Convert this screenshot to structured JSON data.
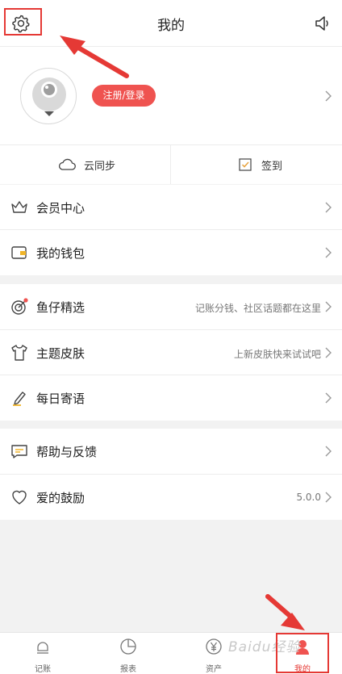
{
  "header": {
    "title": "我的"
  },
  "profile": {
    "login_label": "注册/登录"
  },
  "sync": {
    "cloud_label": "云同步",
    "checkin_label": "签到"
  },
  "menu": [
    {
      "label": "会员中心",
      "icon": "crown-icon"
    },
    {
      "label": "我的钱包",
      "icon": "wallet-icon"
    },
    {
      "label": "鱼仔精选",
      "sub": "记账分钱、社区话题都在这里",
      "icon": "target-icon"
    },
    {
      "label": "主题皮肤",
      "sub": "上新皮肤快来试试吧",
      "icon": "tshirt-icon"
    },
    {
      "label": "每日寄语",
      "icon": "pen-icon"
    },
    {
      "label": "帮助与反馈",
      "icon": "chat-icon"
    },
    {
      "label": "爱的鼓励",
      "sub": "5.0.0",
      "icon": "heart-icon"
    }
  ],
  "tabs": [
    {
      "label": "记账",
      "icon": "ledger-icon"
    },
    {
      "label": "报表",
      "icon": "pie-chart-icon"
    },
    {
      "label": "资产",
      "icon": "yen-icon"
    },
    {
      "label": "我的",
      "icon": "profile-icon",
      "active": true
    }
  ],
  "watermark": "Baidu经验",
  "colors": {
    "accent": "#ef5350",
    "annotation": "#e53935"
  }
}
